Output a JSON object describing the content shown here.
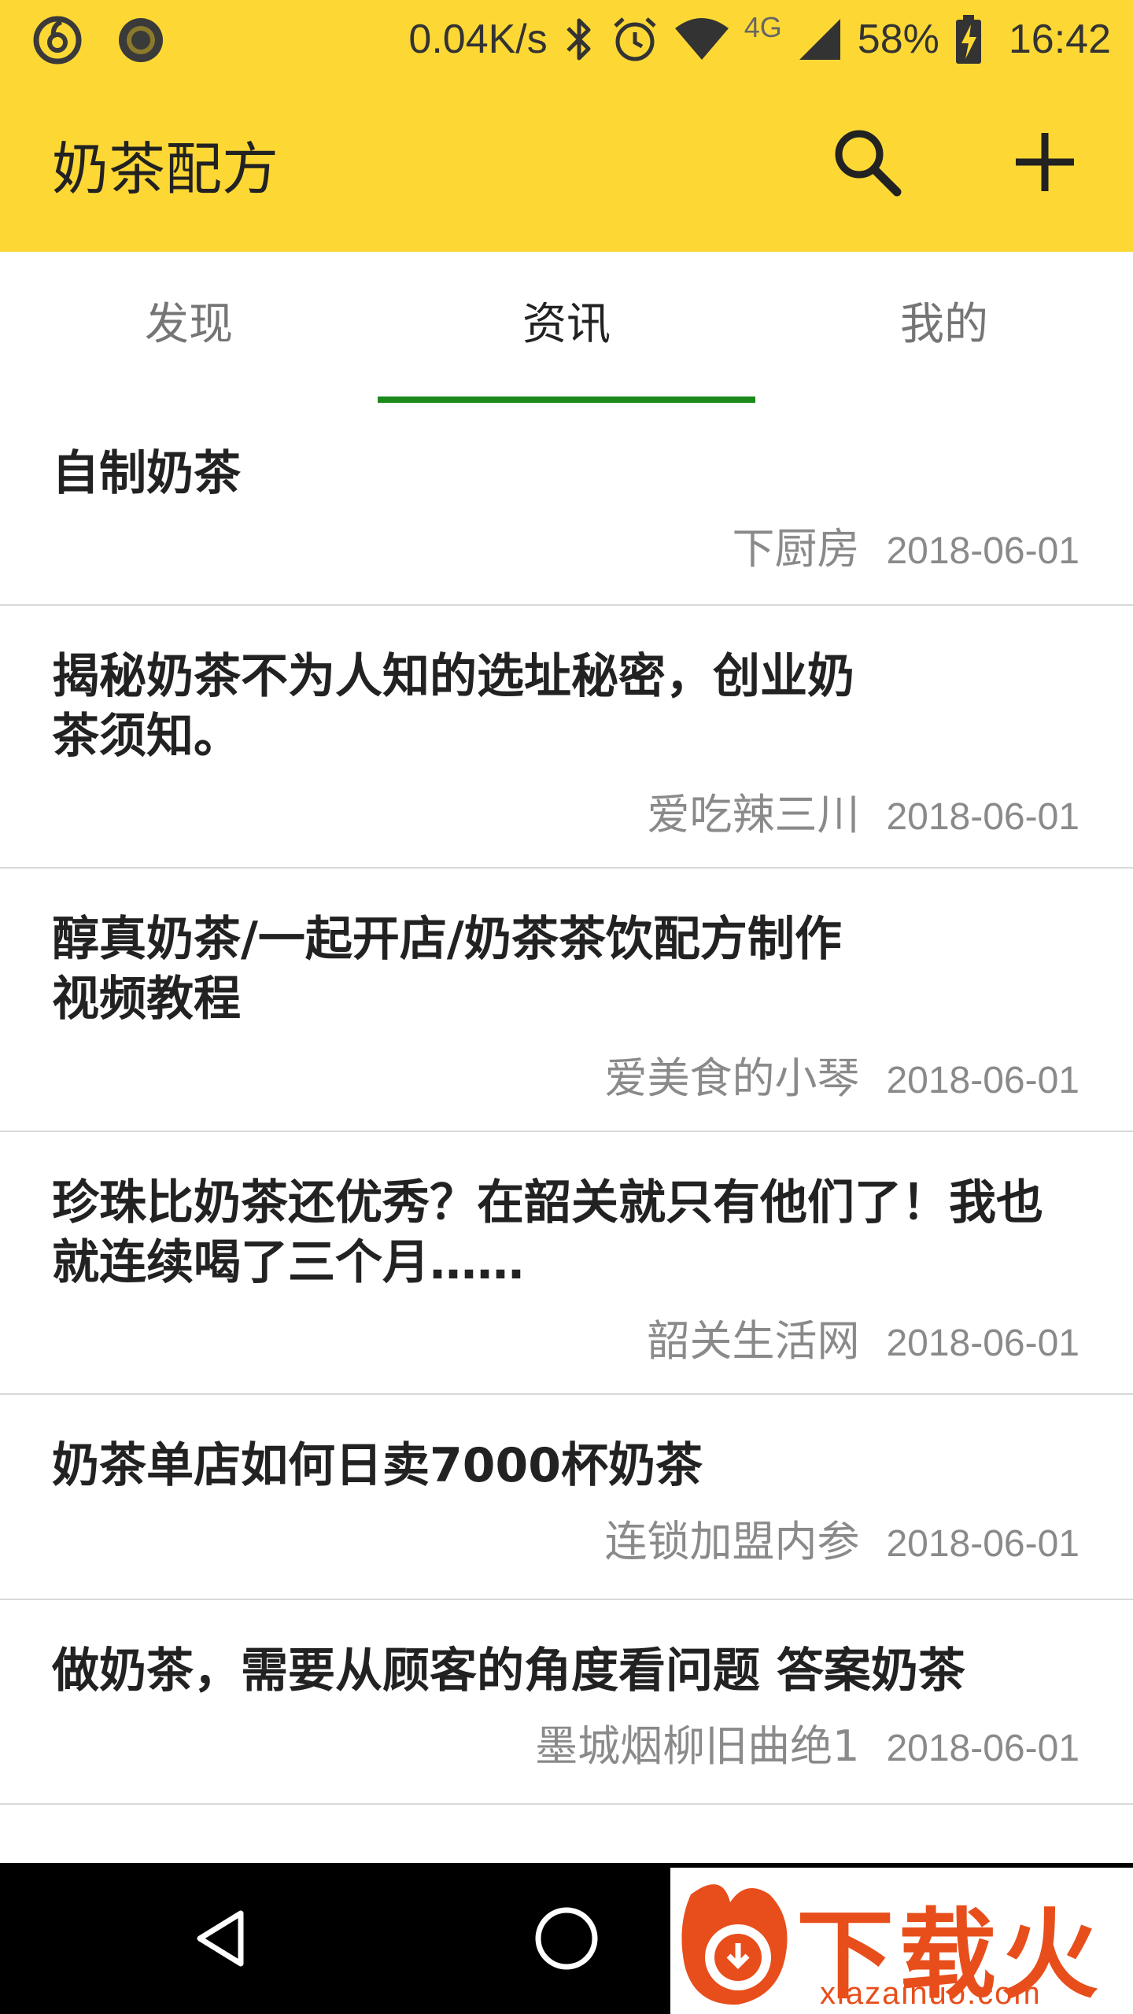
{
  "status_bar": {
    "network_speed": "0.04K/s",
    "network_type": "4G",
    "battery": "58%",
    "time": "16:42"
  },
  "toolbar": {
    "title": "奶茶配方"
  },
  "tabs": [
    {
      "label": "发现",
      "active": false
    },
    {
      "label": "资讯",
      "active": true
    },
    {
      "label": "我的",
      "active": false
    }
  ],
  "articles": [
    {
      "title": "自制奶茶",
      "source": "下厨房",
      "date": "2018-06-01"
    },
    {
      "title": "揭秘奶茶不为人知的选址秘密，创业奶茶须知。",
      "source": "爱吃辣三川",
      "date": "2018-06-01"
    },
    {
      "title": "醇真奶茶/一起开店/奶茶茶饮配方制作视频教程",
      "source": "爱美食的小琴",
      "date": "2018-06-01"
    },
    {
      "title": "珍珠比奶茶还优秀？在韶关就只有他们了！我也就连续喝了三个月……",
      "source": "韶关生活网",
      "date": "2018-06-01"
    },
    {
      "title": "奶茶单店如何日卖7000杯奶茶",
      "source": "连锁加盟内参",
      "date": "2018-06-01"
    },
    {
      "title": "做奶茶，需要从顾客的角度看问题 答案奶茶",
      "source": "墨城烟柳旧曲绝1",
      "date": "2018-06-01"
    }
  ],
  "watermark": {
    "text": "下载火",
    "domain": "xiazaihuo.com"
  },
  "colors": {
    "toolbar_bg": "#FDD835",
    "tab_indicator": "#1B8A1B"
  }
}
